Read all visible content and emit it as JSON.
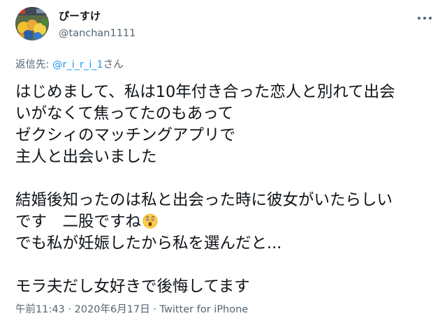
{
  "author": {
    "display_name": "ぴーすけ",
    "handle": "@tanchan1111",
    "avatar_icon": "avatar-image"
  },
  "more_icon": "more-horizontal-icon",
  "reply": {
    "prefix": "返信先: ",
    "mention": "@r_i_r_i_1",
    "suffix": "さん"
  },
  "body": {
    "lines": [
      "はじめまして、私は10年付き合った恋人と別れて出会",
      "いがなくて焦ってたのもあって",
      "ゼクシィのマッチングアプリで",
      "主人と出会いました",
      "",
      "結婚後知ったのは私と出会った時に彼女がいたらしい",
      "です　二股ですね",
      "でも私が妊娠したから私を選んだと...",
      "",
      "モラ夫だし女好きで後悔してます"
    ],
    "emoji": "astonished-face-emoji"
  },
  "meta": {
    "time": "午前11:43",
    "separator1": " · ",
    "date": "2020年6月17日",
    "separator2": " · ",
    "source": "Twitter for iPhone"
  },
  "colors": {
    "text": "#0f1419",
    "secondary": "#536471",
    "link": "#1d9bf0"
  }
}
